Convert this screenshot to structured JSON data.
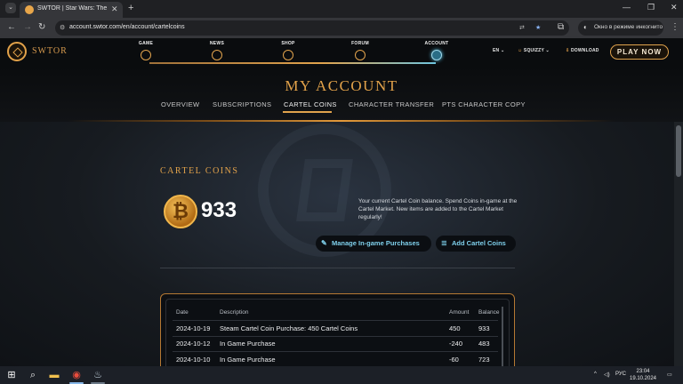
{
  "browser": {
    "tab_title": "SWTOR | Star Wars: The Old Re",
    "url": "account.swtor.com/en/account/cartelcoins",
    "incognito_label": "Окно в режиме инкогнито"
  },
  "site": {
    "logo_text": "SWTOR",
    "nav": [
      {
        "label": "GAME"
      },
      {
        "label": "NEWS"
      },
      {
        "label": "SHOP"
      },
      {
        "label": "FORUM"
      },
      {
        "label": "ACCOUNT",
        "active": true
      }
    ],
    "language": "EN",
    "username": "SQUIZZY",
    "download_label": "DOWNLOAD",
    "play_now_label": "PLAY NOW"
  },
  "account": {
    "title": "MY ACCOUNT",
    "tabs": [
      {
        "label": "OVERVIEW"
      },
      {
        "label": "SUBSCRIPTIONS"
      },
      {
        "label": "CARTEL COINS",
        "active": true
      },
      {
        "label": "CHARACTER TRANSFER"
      },
      {
        "label": "PTS CHARACTER COPY"
      }
    ]
  },
  "cartel": {
    "section_title": "CARTEL COINS",
    "balance": "933",
    "description": "Your current Cartel Coin balance. Spend Coins in-game at the Cartel Market. New items are added to the Cartel Market regularly!",
    "manage_button": "Manage In-game Purchases",
    "add_button": "Add Cartel Coins",
    "table": {
      "headers": [
        "Date",
        "Description",
        "Amount",
        "Balance"
      ],
      "rows": [
        {
          "date": "2024-10-19",
          "description": "Steam Cartel Coin Purchase: 450 Cartel Coins",
          "amount": "450",
          "balance": "933"
        },
        {
          "date": "2024-10-12",
          "description": "In Game Purchase",
          "amount": "-240",
          "balance": "483"
        },
        {
          "date": "2024-10-10",
          "description": "In Game Purchase",
          "amount": "-60",
          "balance": "723"
        }
      ]
    }
  },
  "taskbar": {
    "language": "РУС",
    "time": "23:04",
    "date": "19.10.2024"
  },
  "colors": {
    "accent_gold": "#e2a24a",
    "accent_cyan": "#7fd0ec",
    "background": "#0d0f11"
  }
}
